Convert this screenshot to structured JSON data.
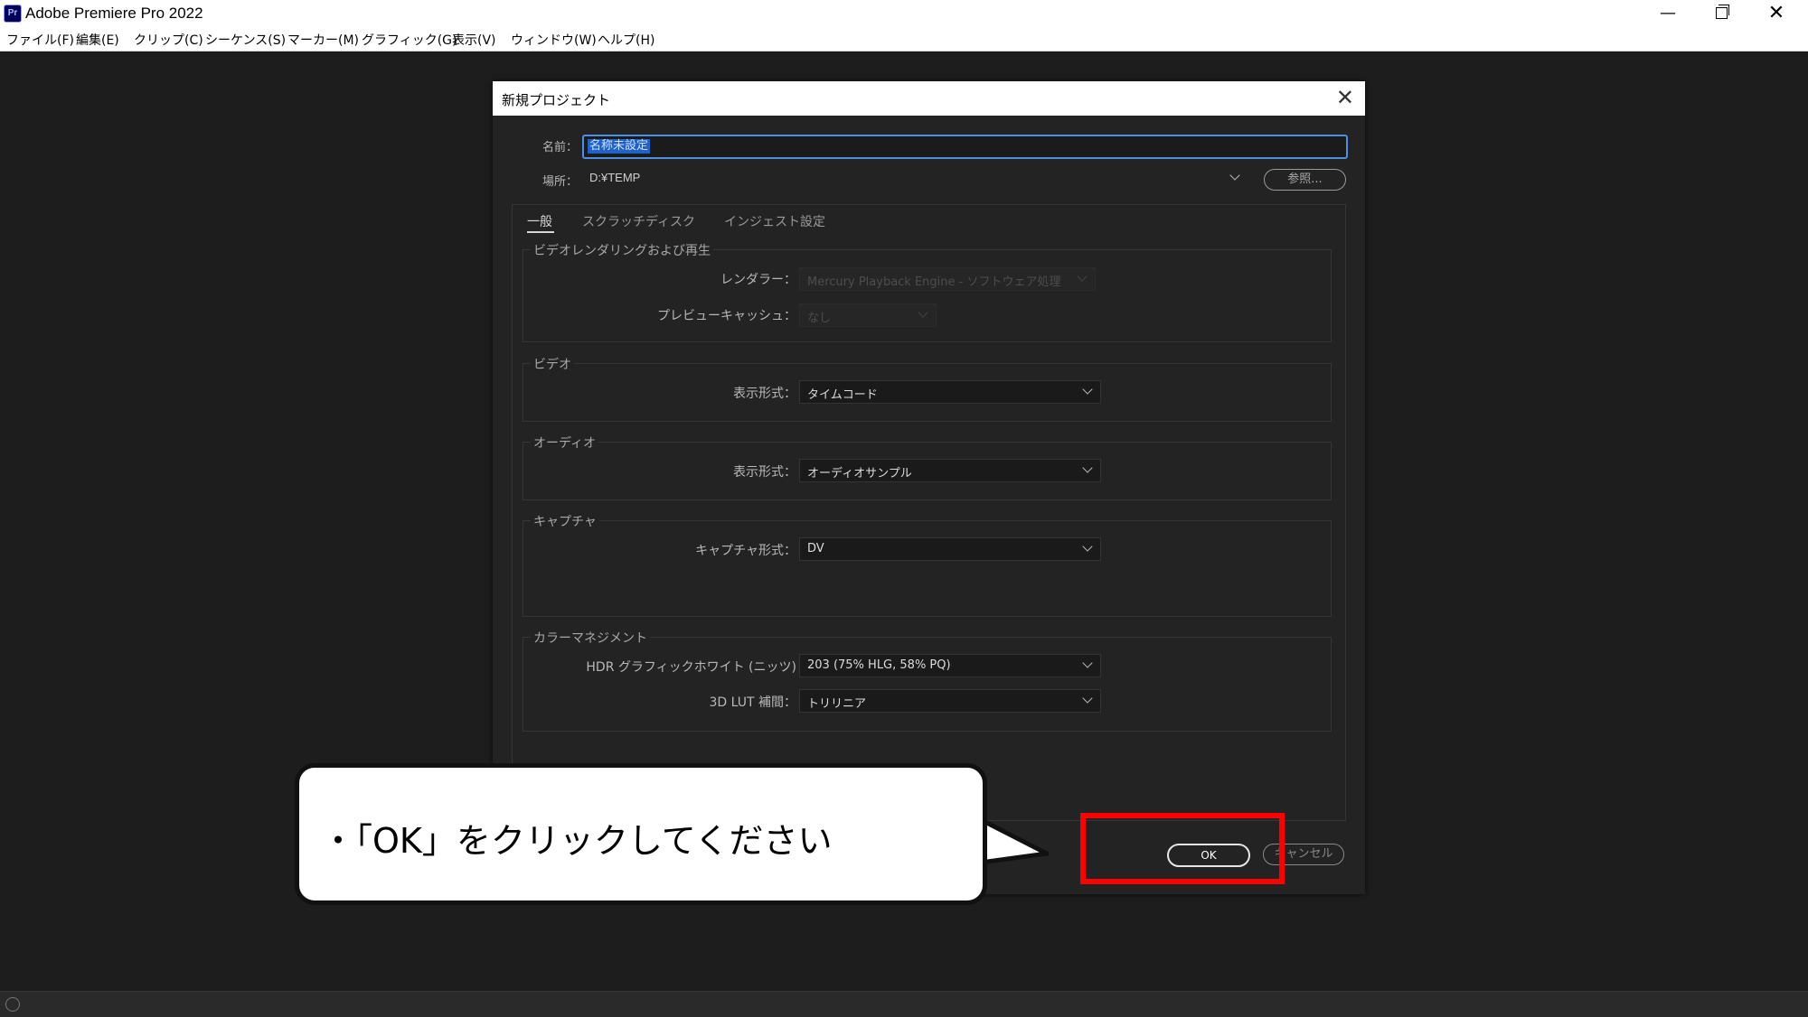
{
  "window": {
    "app_icon": "Pr",
    "title": "Adobe Premiere Pro 2022",
    "controls": {
      "minimize": "—",
      "close": "✕"
    }
  },
  "menu": [
    "ファイル(F)",
    "編集(E)",
    "クリップ(C)",
    "シーケンス(S)",
    "マーカー(M)",
    "グラフィック(G)",
    "表示(V)",
    "ウィンドウ(W)",
    "ヘルプ(H)"
  ],
  "dialog": {
    "title": "新規プロジェクト",
    "close": "✕",
    "name_label": "名前：",
    "name_value": "名称未設定",
    "location_label": "場所：",
    "location_value": "D:¥TEMP",
    "browse": "参照...",
    "tabs": [
      "一般",
      "スクラッチディスク",
      "インジェスト設定"
    ],
    "active_tab": "一般",
    "sections": {
      "video_render": {
        "title": "ビデオレンダリングおよび再生",
        "renderer_label": "レンダラー：",
        "renderer_value": "Mercury Playback Engine - ソフトウェア処理",
        "preview_cache_label": "プレビューキャッシュ：",
        "preview_cache_value": "なし"
      },
      "video": {
        "title": "ビデオ",
        "display_format_label": "表示形式：",
        "display_format_value": "タイムコード"
      },
      "audio": {
        "title": "オーディオ",
        "display_format_label": "表示形式：",
        "display_format_value": "オーディオサンプル"
      },
      "capture": {
        "title": "キャプチャ",
        "capture_format_label": "キャプチャ形式：",
        "capture_format_value": "DV"
      },
      "color": {
        "title": "カラーマネジメント",
        "hdr_label": "HDR グラフィックホワイト (ニッツ)",
        "hdr_value": "203 (75% HLG, 58% PQ)",
        "lut_label": "3D LUT 補間：",
        "lut_value": "トリリニア"
      }
    },
    "ok": "OK",
    "cancel": "キャンセル"
  },
  "callout": {
    "text": "・「OK」をクリックしてください"
  },
  "colors": {
    "highlight": "#ff0000",
    "selection": "#1f63c9",
    "focus_border": "#4d8fe3"
  }
}
